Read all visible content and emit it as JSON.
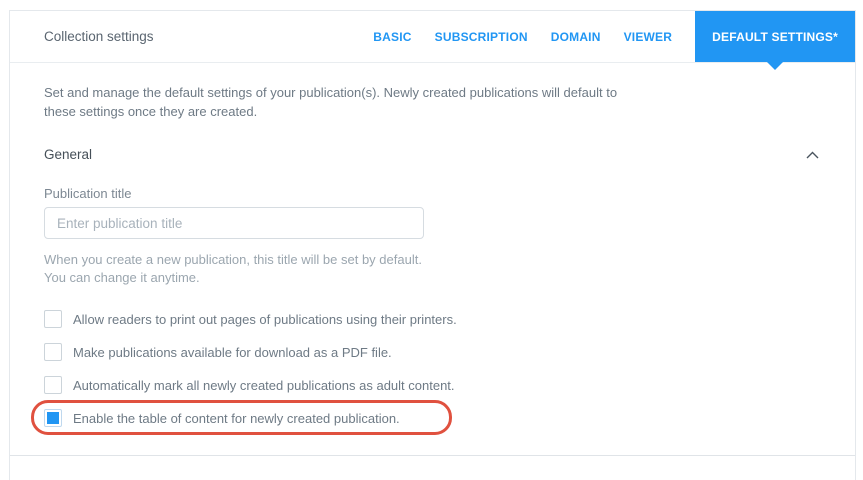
{
  "header": {
    "title": "Collection settings",
    "tabs": [
      {
        "label": "BASIC",
        "active": false
      },
      {
        "label": "SUBSCRIPTION",
        "active": false
      },
      {
        "label": "DOMAIN",
        "active": false
      },
      {
        "label": "VIEWER",
        "active": false
      },
      {
        "label": "DEFAULT SETTINGS*",
        "active": true
      }
    ]
  },
  "description": "Set and manage the default settings of your publication(s). Newly created publications will default to these settings once they are created.",
  "general": {
    "title": "General",
    "collapse_icon": "chevron-up"
  },
  "publication_title": {
    "label": "Publication title",
    "value": "",
    "placeholder": "Enter publication title",
    "helper_line1": "When you create a new publication, this title will be set by default.",
    "helper_line2": "You can change it anytime."
  },
  "checkboxes": [
    {
      "label": "Allow readers to print out pages of publications using their printers.",
      "checked": false
    },
    {
      "label": "Make publications available for download as a PDF file.",
      "checked": false
    },
    {
      "label": "Automatically mark all newly created publications as adult content.",
      "checked": false
    },
    {
      "label": "Enable the table of content for newly created publication.",
      "checked": true,
      "highlighted": true
    }
  ],
  "colors": {
    "accent_blue": "#2196f3",
    "annotation_red": "#e0513f"
  }
}
